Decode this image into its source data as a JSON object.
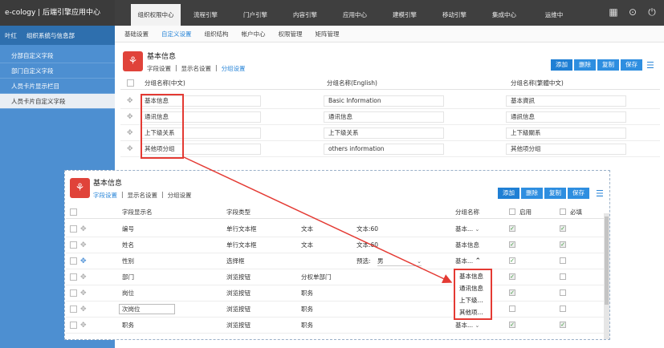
{
  "app": {
    "brand": "e-cology | 后端引擎应用中心"
  },
  "top_tabs": [
    "组织权限中心",
    "流程引擎",
    "门户引擎",
    "内容引擎",
    "应用中心",
    "建模引擎",
    "移动引擎",
    "集成中心",
    "运维中"
  ],
  "top_icons": [
    "grid-icon",
    "more-icon",
    "power-icon"
  ],
  "sidebar": {
    "user": "叶红",
    "group": "组织系统与信息部",
    "items": [
      "分部自定义字段",
      "部门自定义字段",
      "人员卡片显示栏目",
      "人员卡片自定义字段"
    ]
  },
  "sub_tabs": [
    "基础设置",
    "自定义设置",
    "组织结构",
    "帐户中心",
    "权限管理",
    "矩阵管理"
  ],
  "panel_top": {
    "title": "基本信息",
    "links": [
      "字段设置",
      "|",
      "显示名设置",
      "|",
      "分组设置"
    ],
    "buttons": [
      "添加",
      "删除",
      "复制",
      "保存"
    ],
    "columns": [
      "分组名称(中文)",
      "分组名称(English)",
      "分组名称(繁體中文)"
    ],
    "rows": [
      [
        "基本信息",
        "Basic Information",
        "基本資訊"
      ],
      [
        "通讯信息",
        "通讯信息",
        "通訊信息"
      ],
      [
        "上下级关系",
        "上下级关系",
        "上下級關系"
      ],
      [
        "其他项分组",
        "others information",
        "其他项分组"
      ]
    ]
  },
  "panel_bottom": {
    "title": "基本信息",
    "links": [
      "字段设置",
      "|",
      "显示名设置",
      "|",
      "分组设置"
    ],
    "buttons": [
      "添加",
      "删除",
      "复制",
      "保存"
    ],
    "columns": [
      "字段显示名",
      "字段类型",
      "分组名称",
      "启用",
      "必填"
    ],
    "rows": [
      {
        "name": "编号",
        "type": "单行文本框",
        "sub": "文本",
        "extra": "文本:60",
        "group": "基本...",
        "enabled": true,
        "required": true
      },
      {
        "name": "姓名",
        "type": "单行文本框",
        "sub": "文本",
        "extra": "文本:60",
        "group": "基本信息",
        "enabled": true,
        "required": true
      },
      {
        "name": "性别",
        "type": "选择框",
        "sub": "",
        "extra": "预选:",
        "extra_value": "男",
        "group": "基本...",
        "enabled": true,
        "required": false
      },
      {
        "name": "部门",
        "type": "浏览按钮",
        "sub": "分权单部门",
        "extra": "",
        "group": "",
        "enabled": true,
        "required": false
      },
      {
        "name": "岗位",
        "type": "浏览按钮",
        "sub": "职务",
        "extra": "",
        "group": "",
        "enabled": true,
        "required": false
      },
      {
        "name": "次岗位",
        "type": "浏览按钮",
        "sub": "职务",
        "extra": "",
        "group": "",
        "enabled": false,
        "required": false
      },
      {
        "name": "职务",
        "type": "浏览按钮",
        "sub": "职务",
        "extra": "",
        "group": "基本...",
        "enabled": true,
        "required": true
      }
    ],
    "dropdown_options": [
      "基本信息",
      "通讯信息",
      "上下级...",
      "其他项..."
    ]
  },
  "colors": {
    "accent": "#2e8ee0",
    "highlight": "#e43a33",
    "sidebar": "#4d8fd1",
    "topbar": "#3f3f3f"
  }
}
